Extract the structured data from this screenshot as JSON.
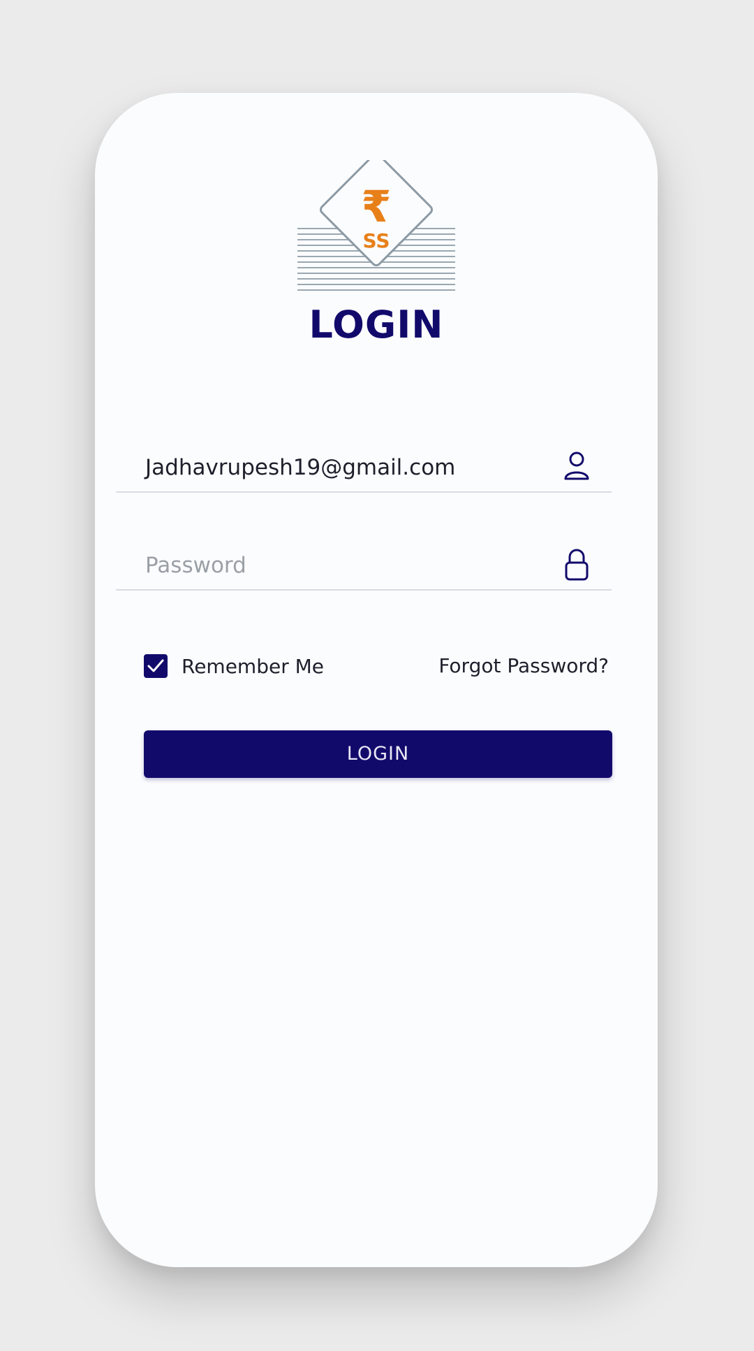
{
  "brand": {
    "logo_symbol": "₹",
    "logo_letters": "SS",
    "logo_icon": "rupee-envelope-logo",
    "accent_color": "#e8801a"
  },
  "page": {
    "title": "LOGIN"
  },
  "form": {
    "email_value": "Jadhavrupesh19@gmail.com",
    "email_icon": "user-icon",
    "password_placeholder": "Password",
    "password_icon": "lock-icon",
    "remember_label": "Remember Me",
    "remember_checked": true,
    "forgot_label": "Forgot Password?",
    "login_label": "LOGIN"
  },
  "colors": {
    "primary": "#120a6b",
    "background": "#fbfcfe",
    "outer_background": "#ebebeb",
    "divider": "#d7dbe0"
  }
}
